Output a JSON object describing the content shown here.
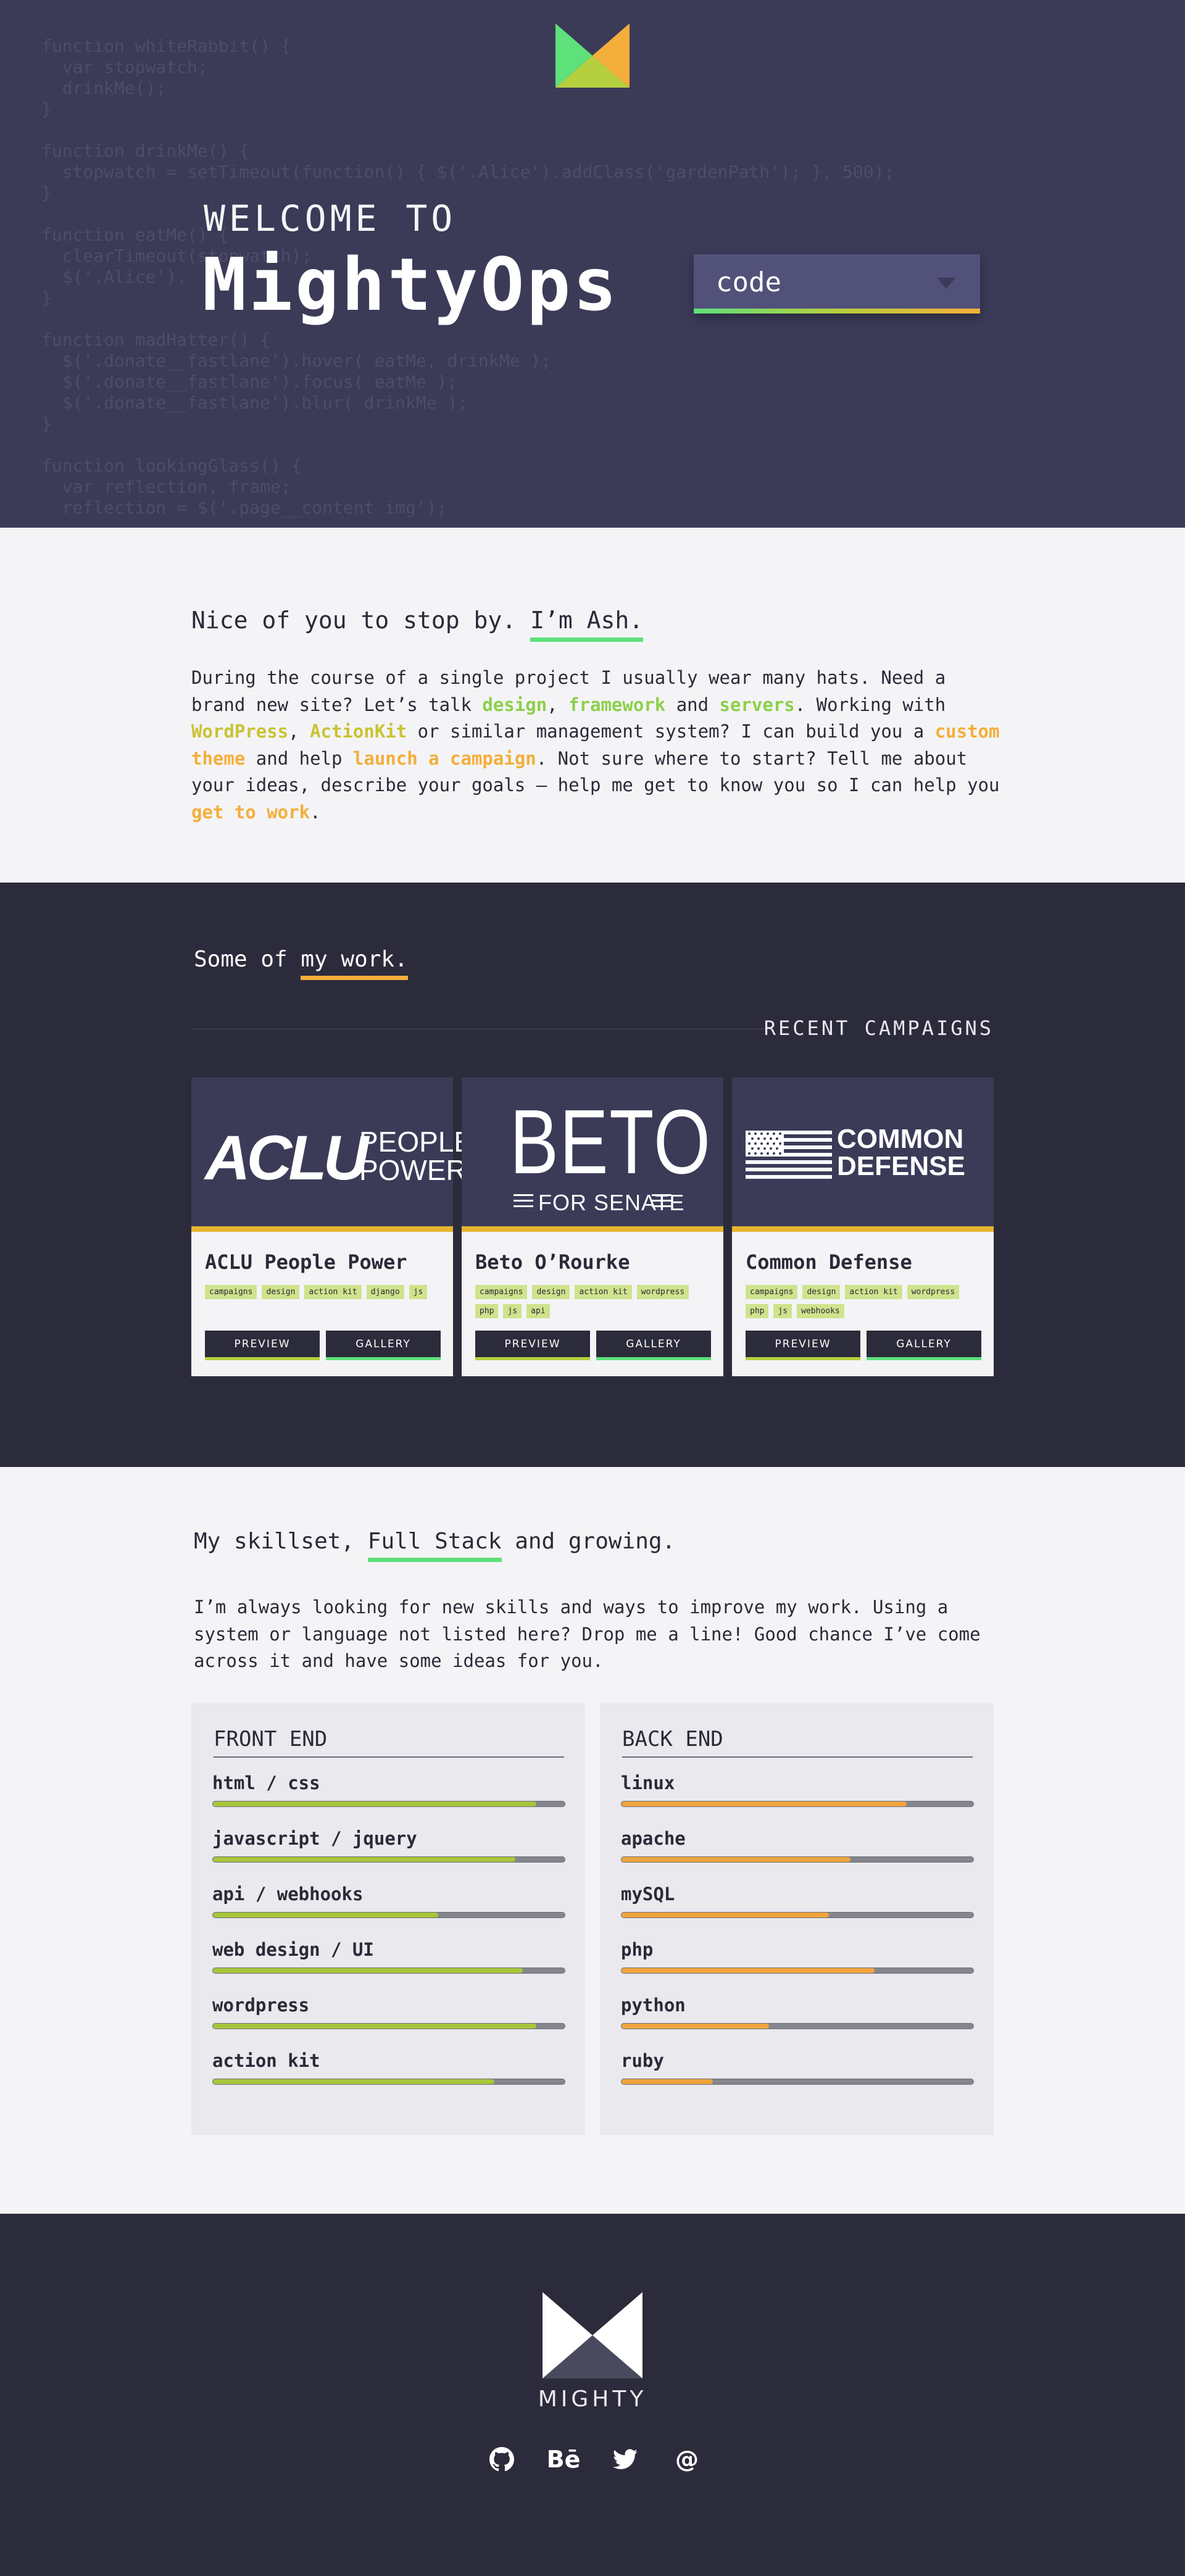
{
  "hero": {
    "bg_code": "function whiteRabbit() {\n  var stopwatch;\n  drinkMe();\n}\n\nfunction drinkMe() {\n  stopwatch = setTimeout(function() { $('.Alice').addClass('gardenPath'); }, 500);\n}\n\nfunction eatMe() {\n  clearTimeout(stopwatch);\n  $('.Alice').\n}\n\nfunction madHatter() {\n  $('.donate__fastlane').hover( eatMe, drinkMe );\n  $('.donate__fastlane').focus( eatMe );\n  $('.donate__fastlane').blur( drinkMe );\n}\n\nfunction lookingGlass() {\n  var reflection, frame;\n  reflection = $('.page__content img');",
    "welcome": "WELCOME TO",
    "brand": "MightyOps",
    "select_value": "code"
  },
  "intro": {
    "heading_pre": "Nice of you to stop by. ",
    "heading_name": "I’m Ash.",
    "p1": "During the course of a single project I usually wear many hats.  Need a brand new site?  Let’s talk ",
    "design": "design",
    "comma1": ", ",
    "framework": "framework",
    "and1": " and ",
    "servers": "servers",
    "p2": ".  Working with ",
    "wordpress": "WordPress",
    "comma2": ", ",
    "actionkit": "ActionKit",
    "p3": " or similar management system?  I can build you a ",
    "custom_theme": "custom theme",
    "p4": " and help ",
    "launch": "launch a campaign",
    "p5": ".  Not sure where to start?  Tell me about your ideas, describe your goals — help me get to know you so I can help you ",
    "get_to_work": "get to work",
    "p6": "."
  },
  "work": {
    "heading_pre": "Some of ",
    "heading_hl": "my work.",
    "recent_label": "RECENT CAMPAIGNS",
    "preview_label": "PREVIEW",
    "gallery_label": "GALLERY",
    "cards": [
      {
        "title": "ACLU People Power",
        "tags": [
          "campaigns",
          "design",
          "action kit",
          "django",
          "js"
        ],
        "logo_main": "ACLU",
        "logo_sub1": "PEOPLE",
        "logo_sub2": "POWER"
      },
      {
        "title": "Beto O’Rourke",
        "tags": [
          "campaigns",
          "design",
          "action kit",
          "wordpress",
          "php",
          "js",
          "api"
        ],
        "logo_main": "BETO",
        "logo_sub1": "FOR SENATE"
      },
      {
        "title": "Common Defense",
        "tags": [
          "campaigns",
          "design",
          "action kit",
          "wordpress",
          "php",
          "js",
          "webhooks"
        ],
        "logo_sub1": "COMMON",
        "logo_sub2": "DEFENSE"
      }
    ]
  },
  "skills": {
    "heading_pre": "My skillset, ",
    "heading_hl": "Full Stack",
    "heading_post": " and growing.",
    "paragraph": "I’m always looking for new skills and ways to improve my work.  Using a system or language not listed here?  Drop me a line!  Good chance I’ve come across it and have some ideas for you.",
    "front_title": "FRONT END",
    "back_title": "BACK END",
    "front": [
      {
        "name": "html / css",
        "level": 0.92
      },
      {
        "name": "javascript / jquery",
        "level": 0.86
      },
      {
        "name": "api / webhooks",
        "level": 0.64
      },
      {
        "name": "web design / UI",
        "level": 0.88
      },
      {
        "name": "wordpress",
        "level": 0.92
      },
      {
        "name": "action kit",
        "level": 0.8
      }
    ],
    "back": [
      {
        "name": "linux",
        "level": 0.81
      },
      {
        "name": "apache",
        "level": 0.65
      },
      {
        "name": "mySQL",
        "level": 0.59
      },
      {
        "name": "php",
        "level": 0.72
      },
      {
        "name": "python",
        "level": 0.42
      },
      {
        "name": "ruby",
        "level": 0.26
      }
    ]
  },
  "footer": {
    "name": "MIGHTY",
    "socials": [
      "github-icon",
      "behance-icon",
      "twitter-icon",
      "at-icon"
    ],
    "behance_text": "Bē",
    "at_text": "@"
  },
  "colors": {
    "hero_bg": "#3b3b58",
    "dark_bg": "#2b2b3b",
    "green": "#5ee07a",
    "orange": "#f4ae3a",
    "tag_bg": "#cfe38c"
  }
}
